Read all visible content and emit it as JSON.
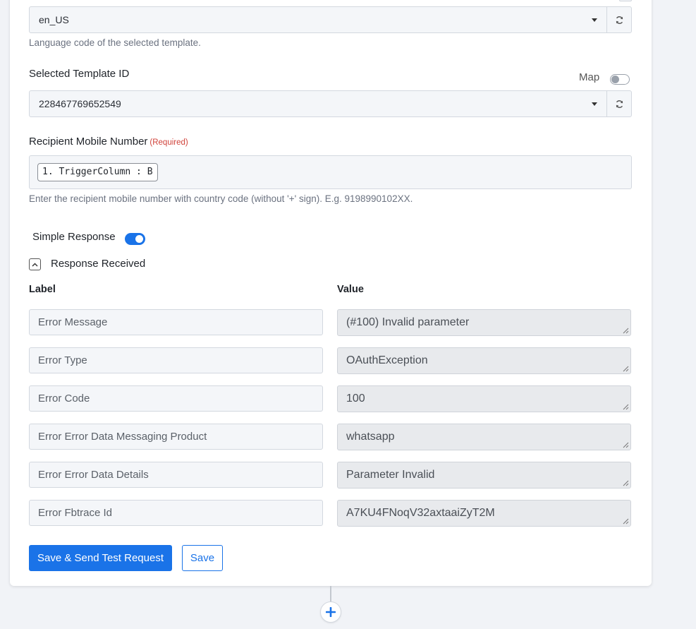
{
  "language": {
    "value": "en_US",
    "help": "Language code of the selected template."
  },
  "template": {
    "label": "Selected Template ID",
    "map_label": "Map",
    "value": "228467769652549"
  },
  "recipient": {
    "label": "Recipient Mobile Number",
    "required": "(Required)",
    "pill": "1. TriggerColumn : B",
    "help": "Enter the recipient mobile number with country code (without '+' sign). E.g. 9198990102XX."
  },
  "simple_response": {
    "label": "Simple Response",
    "enabled": true
  },
  "response": {
    "title": "Response Received",
    "label_header": "Label",
    "value_header": "Value",
    "rows": [
      {
        "label": "Error Message",
        "value": "(#100) Invalid parameter"
      },
      {
        "label": "Error Type",
        "value": "OAuthException"
      },
      {
        "label": "Error Code",
        "value": "100"
      },
      {
        "label": "Error Error Data Messaging Product",
        "value": "whatsapp"
      },
      {
        "label": "Error Error Data Details",
        "value": "Parameter Invalid"
      },
      {
        "label": "Error Fbtrace Id",
        "value": "A7KU4FNoqV32axtaaiZyT2M"
      }
    ]
  },
  "actions": {
    "save_test": "Save & Send Test Request",
    "save": "Save"
  },
  "colors": {
    "accent": "#1a73e8",
    "required": "#d0423a"
  }
}
